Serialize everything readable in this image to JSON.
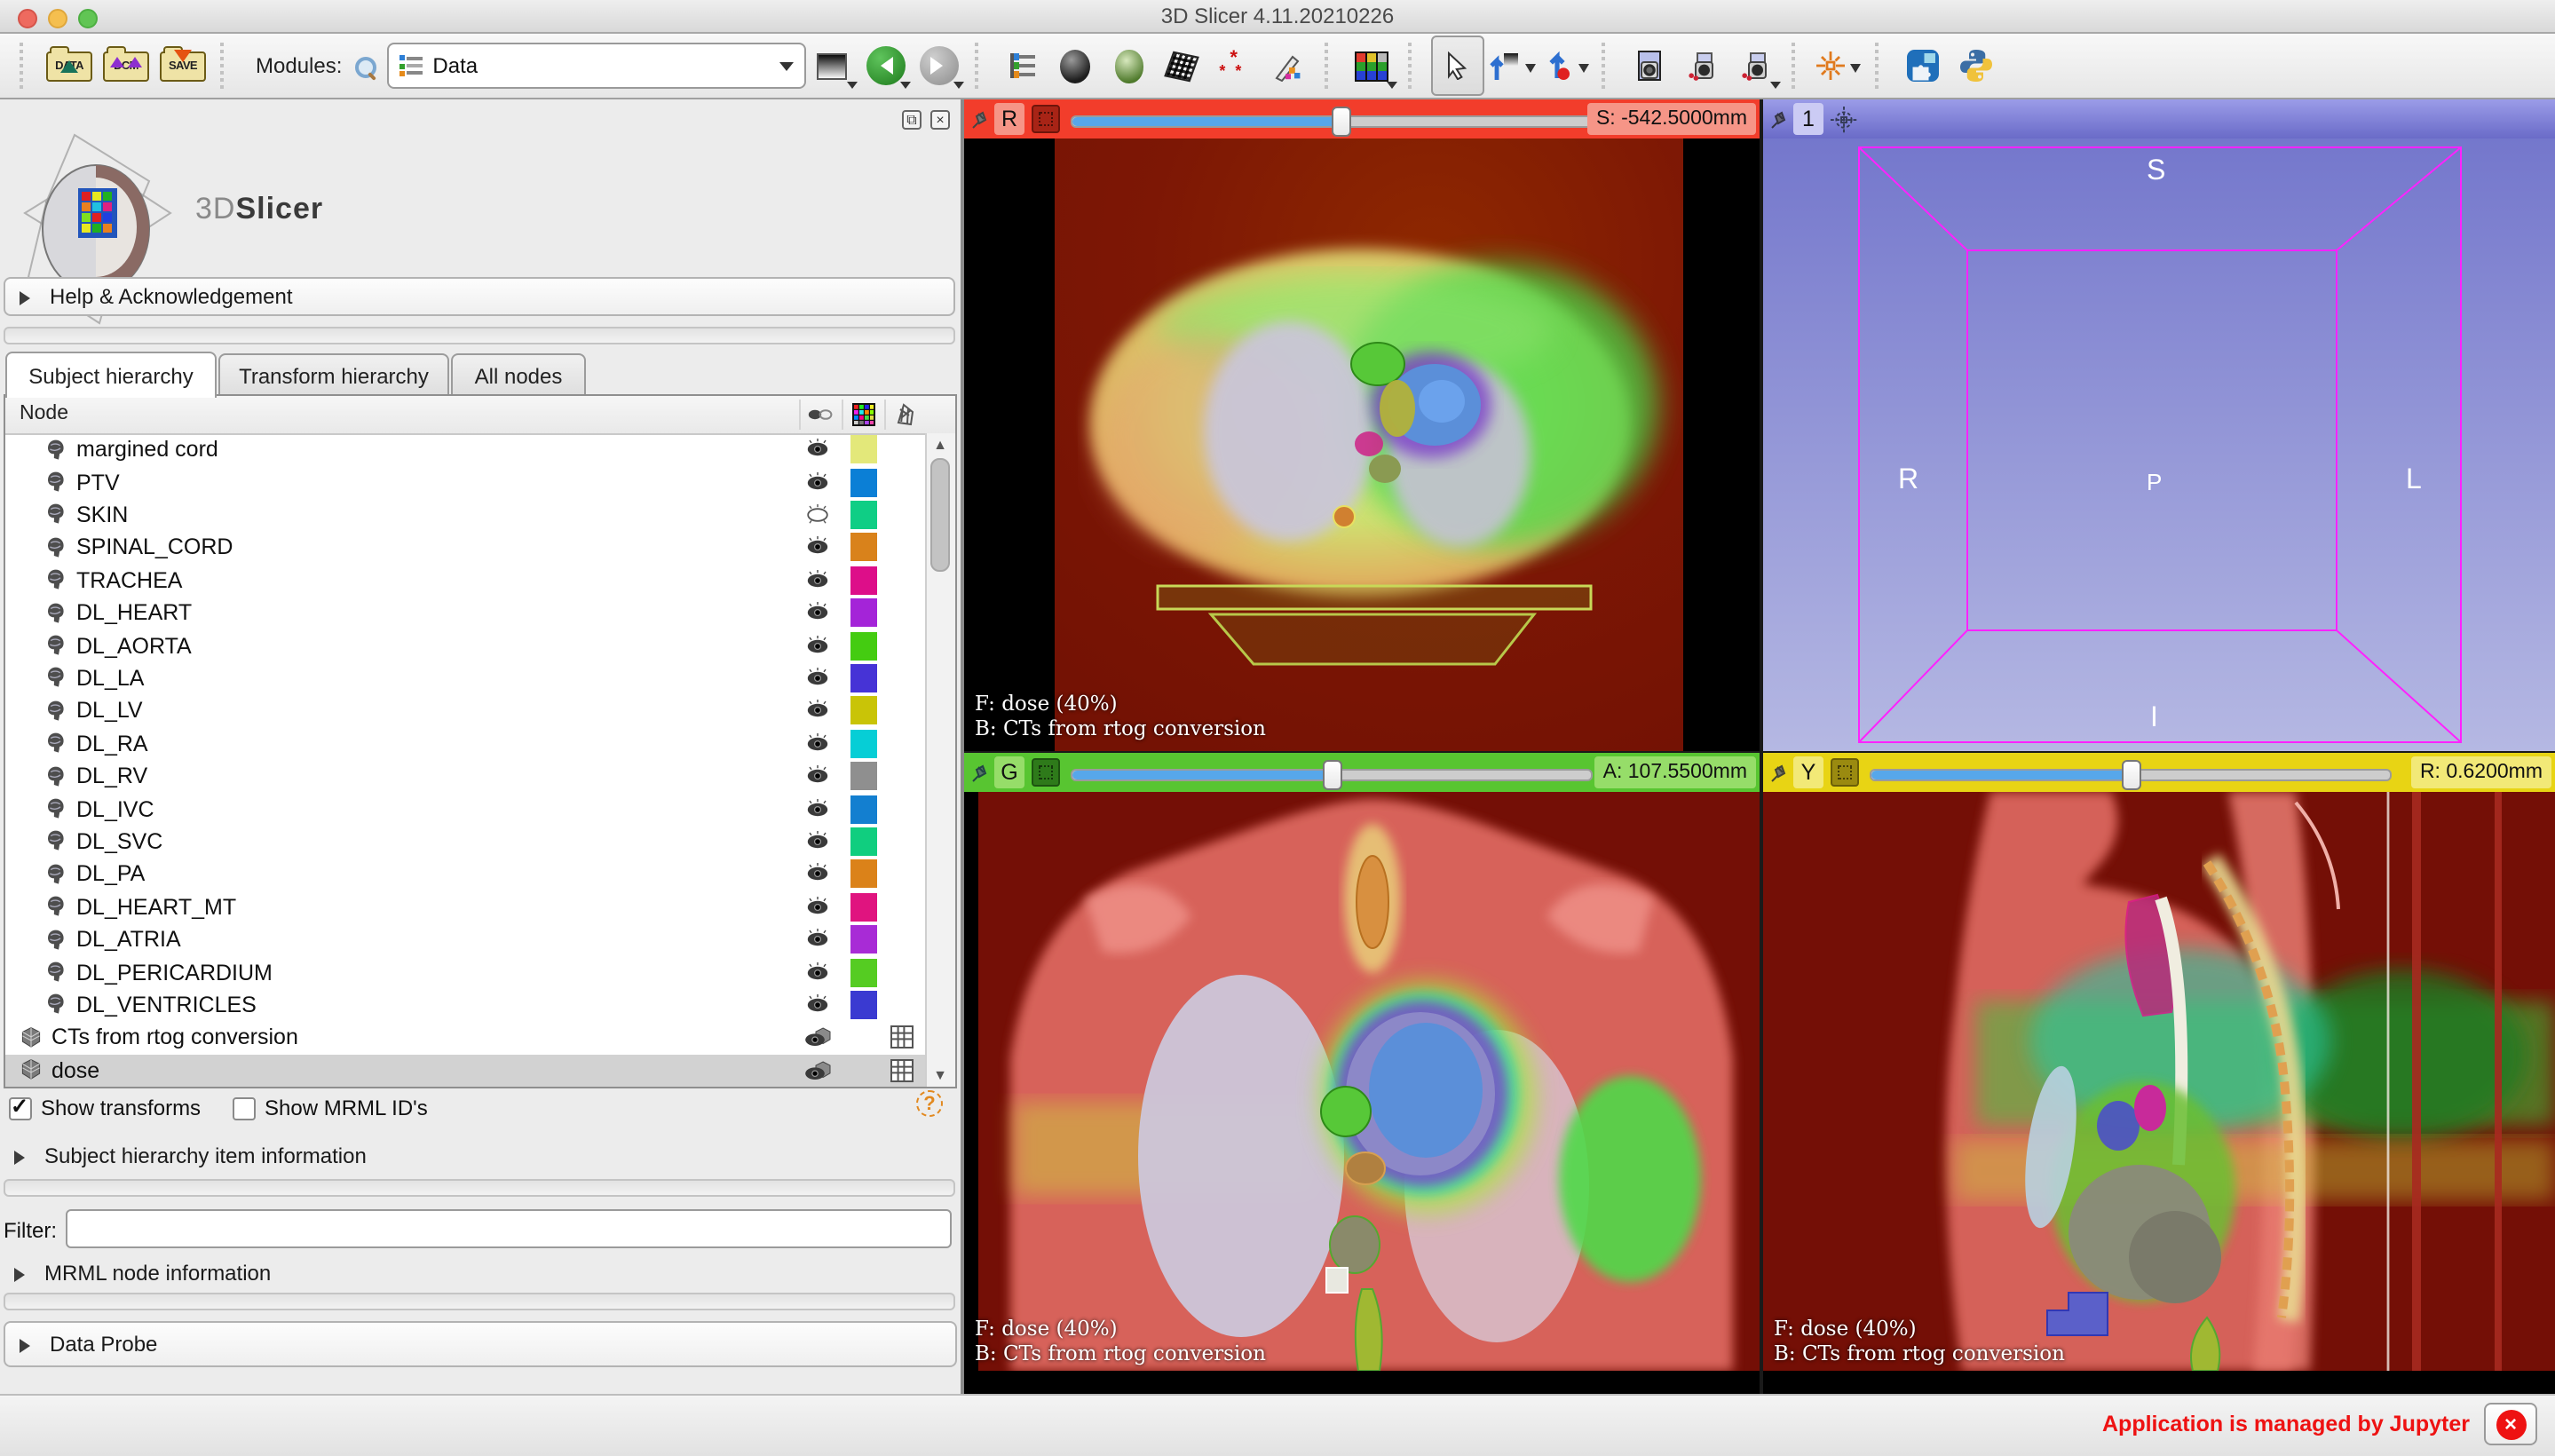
{
  "window": {
    "title": "3D Slicer 4.11.20210226"
  },
  "toolbar": {
    "load_buttons": [
      {
        "label": "DATA"
      },
      {
        "label": "DCM"
      },
      {
        "label": "SAVE"
      }
    ],
    "modules_label": "Modules:",
    "module_selector": {
      "value": "Data"
    }
  },
  "panel": {
    "logo_3d": "3D",
    "logo_slicer": "Slicer",
    "help_section": "Help & Acknowledgement",
    "tabs": [
      {
        "label": "Subject hierarchy",
        "active": true
      },
      {
        "label": "Transform hierarchy",
        "active": false
      },
      {
        "label": "All nodes",
        "active": false
      }
    ],
    "tree": {
      "header": "Node",
      "items": [
        {
          "label": "margined cord",
          "type": "segmentation",
          "color": "#e3e87a",
          "visible": true
        },
        {
          "label": "PTV",
          "type": "segmentation",
          "color": "#0b7fd6",
          "visible": true
        },
        {
          "label": "SKIN",
          "type": "segmentation",
          "color": "#0fce85",
          "visible": false
        },
        {
          "label": "SPINAL_CORD",
          "type": "segmentation",
          "color": "#d9821b",
          "visible": true
        },
        {
          "label": "TRACHEA",
          "type": "segmentation",
          "color": "#dd0e89",
          "visible": true
        },
        {
          "label": "DL_HEART",
          "type": "segmentation",
          "color": "#a424d8",
          "visible": true
        },
        {
          "label": "DL_AORTA",
          "type": "segmentation",
          "color": "#44cc11",
          "visible": true
        },
        {
          "label": "DL_LA",
          "type": "segmentation",
          "color": "#4633d6",
          "visible": true
        },
        {
          "label": "DL_LV",
          "type": "segmentation",
          "color": "#c9c407",
          "visible": true
        },
        {
          "label": "DL_RA",
          "type": "segmentation",
          "color": "#06ced6",
          "visible": true
        },
        {
          "label": "DL_RV",
          "type": "segmentation",
          "color": "#8f8f8f",
          "visible": true
        },
        {
          "label": "DL_IVC",
          "type": "segmentation",
          "color": "#137fd0",
          "visible": true
        },
        {
          "label": "DL_SVC",
          "type": "segmentation",
          "color": "#10ce7f",
          "visible": true
        },
        {
          "label": "DL_PA",
          "type": "segmentation",
          "color": "#db8219",
          "visible": true
        },
        {
          "label": "DL_HEART_MT",
          "type": "segmentation",
          "color": "#e0147f",
          "visible": true
        },
        {
          "label": "DL_ATRIA",
          "type": "segmentation",
          "color": "#a82bd6",
          "visible": true
        },
        {
          "label": "DL_PERICARDIUM",
          "type": "segmentation",
          "color": "#55cc22",
          "visible": true
        },
        {
          "label": "DL_VENTRICLES",
          "type": "segmentation",
          "color": "#3a3ad1",
          "visible": true
        },
        {
          "label": "CTs from rtog conversion",
          "type": "volume",
          "selected": false
        },
        {
          "label": "dose",
          "type": "volume",
          "selected": true
        }
      ]
    },
    "show_transforms_label": "Show transforms",
    "show_transforms_checked": true,
    "show_mrml_label": "Show MRML ID's",
    "show_mrml_checked": false,
    "help_icon": "?",
    "sh_item_info": "Subject hierarchy item information",
    "filter_label": "Filter:",
    "filter_value": "",
    "mrml_info": "MRML node information",
    "data_probe": "Data Probe"
  },
  "views": {
    "overlay_f": "F: dose (40%)",
    "overlay_b": "B: CTs from rtog conversion",
    "red": {
      "letter": "R",
      "value": "S: -542.5000mm",
      "slider_frac": 0.52,
      "bar_color": "#f23d2b",
      "chip_color": "#f69587"
    },
    "green": {
      "letter": "G",
      "value": "A: 107.5500mm",
      "slider_frac": 0.5,
      "bar_color": "#58c531",
      "chip_color": "#96dd69"
    },
    "yellow": {
      "letter": "Y",
      "value": "R: 0.6200mm",
      "slider_frac": 0.5,
      "bar_color": "#e8d414",
      "chip_color": "#f2e977"
    },
    "threeD": {
      "label": "1",
      "letters": {
        "s": "S",
        "r": "R",
        "p": "P",
        "l": "L",
        "i": "I"
      }
    }
  },
  "statusbar": {
    "message": "Application is managed by Jupyter"
  }
}
